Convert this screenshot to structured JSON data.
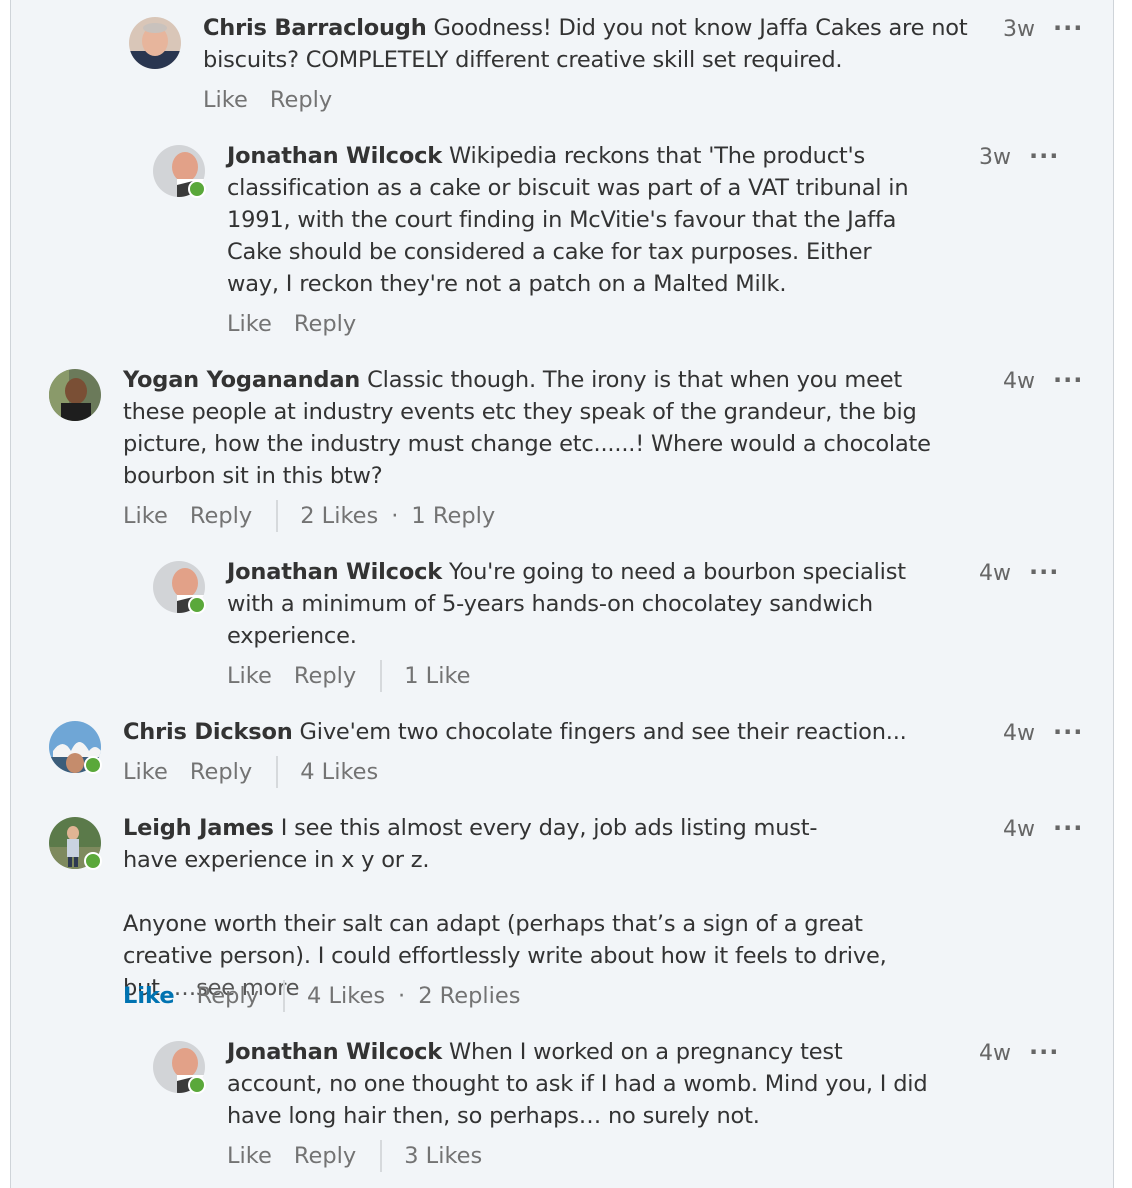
{
  "comments": [
    {
      "author": "Chris Barraclough",
      "text": "Goodness! Did you not know Jaffa Cakes are not biscuits? COMPLETELY different creative skill set required.",
      "time": "3w",
      "more": "···",
      "actions": {
        "like": "Like",
        "reply": "Reply"
      }
    },
    {
      "author": "Jonathan Wilcock",
      "text": "Wikipedia reckons that 'The product's classification as a cake or biscuit was part of a VAT tribunal in 1991, with the court finding in McVitie's favour that the Jaffa Cake should be considered a cake for tax purposes. Either way, I reckon they're not a patch on a Malted Milk.",
      "time": "3w",
      "more": "···",
      "actions": {
        "like": "Like",
        "reply": "Reply"
      }
    },
    {
      "author": "Yogan Yoganandan",
      "text": "Classic though. The irony is that when you meet these people at industry events etc they speak of the grandeur, the big picture, how the industry must change etc......! Where would a chocolate bourbon sit in this btw?",
      "time": "4w",
      "more": "···",
      "actions": {
        "like": "Like",
        "reply": "Reply",
        "likes": "2 Likes",
        "replies": "1 Reply",
        "dot": "·"
      }
    },
    {
      "author": "Jonathan Wilcock",
      "text": "You're going to need a bourbon specialist with a minimum of 5-years hands-on chocolatey sandwich experience.",
      "time": "4w",
      "more": "···",
      "actions": {
        "like": "Like",
        "reply": "Reply",
        "likes": "1 Like"
      }
    },
    {
      "author": "Chris Dickson",
      "text": "Give'em two chocolate fingers and see their reaction...",
      "time": "4w",
      "more": "···",
      "actions": {
        "like": "Like",
        "reply": "Reply",
        "likes": "4 Likes"
      }
    },
    {
      "author": "Leigh James",
      "text_line1": "I see this almost every day, job ads listing must-have experience in x y or z.",
      "text_line2": "Anyone worth their salt can adapt (perhaps that’s a sign of a great creative person). I could effortlessly write about how it feels to drive, but",
      "see_more": "…see more",
      "time": "4w",
      "more": "···",
      "actions": {
        "like": "Like",
        "reply": "Reply",
        "likes": "4 Likes",
        "replies": "2 Replies",
        "dot": "·"
      }
    },
    {
      "author": "Jonathan Wilcock",
      "text": "When I worked on a pregnancy test account, no one thought to ask if I had a womb. Mind you, I did have long hair then, so perhaps… no surely not.",
      "time": "4w",
      "more": "···",
      "actions": {
        "like": "Like",
        "reply": "Reply",
        "likes": "3 Likes"
      }
    }
  ],
  "colors": {
    "panel_bg": "#f2f5f8",
    "text": "#333333",
    "muted": "#737373",
    "like_active": "#0073b1",
    "online": "#5aa83a"
  }
}
